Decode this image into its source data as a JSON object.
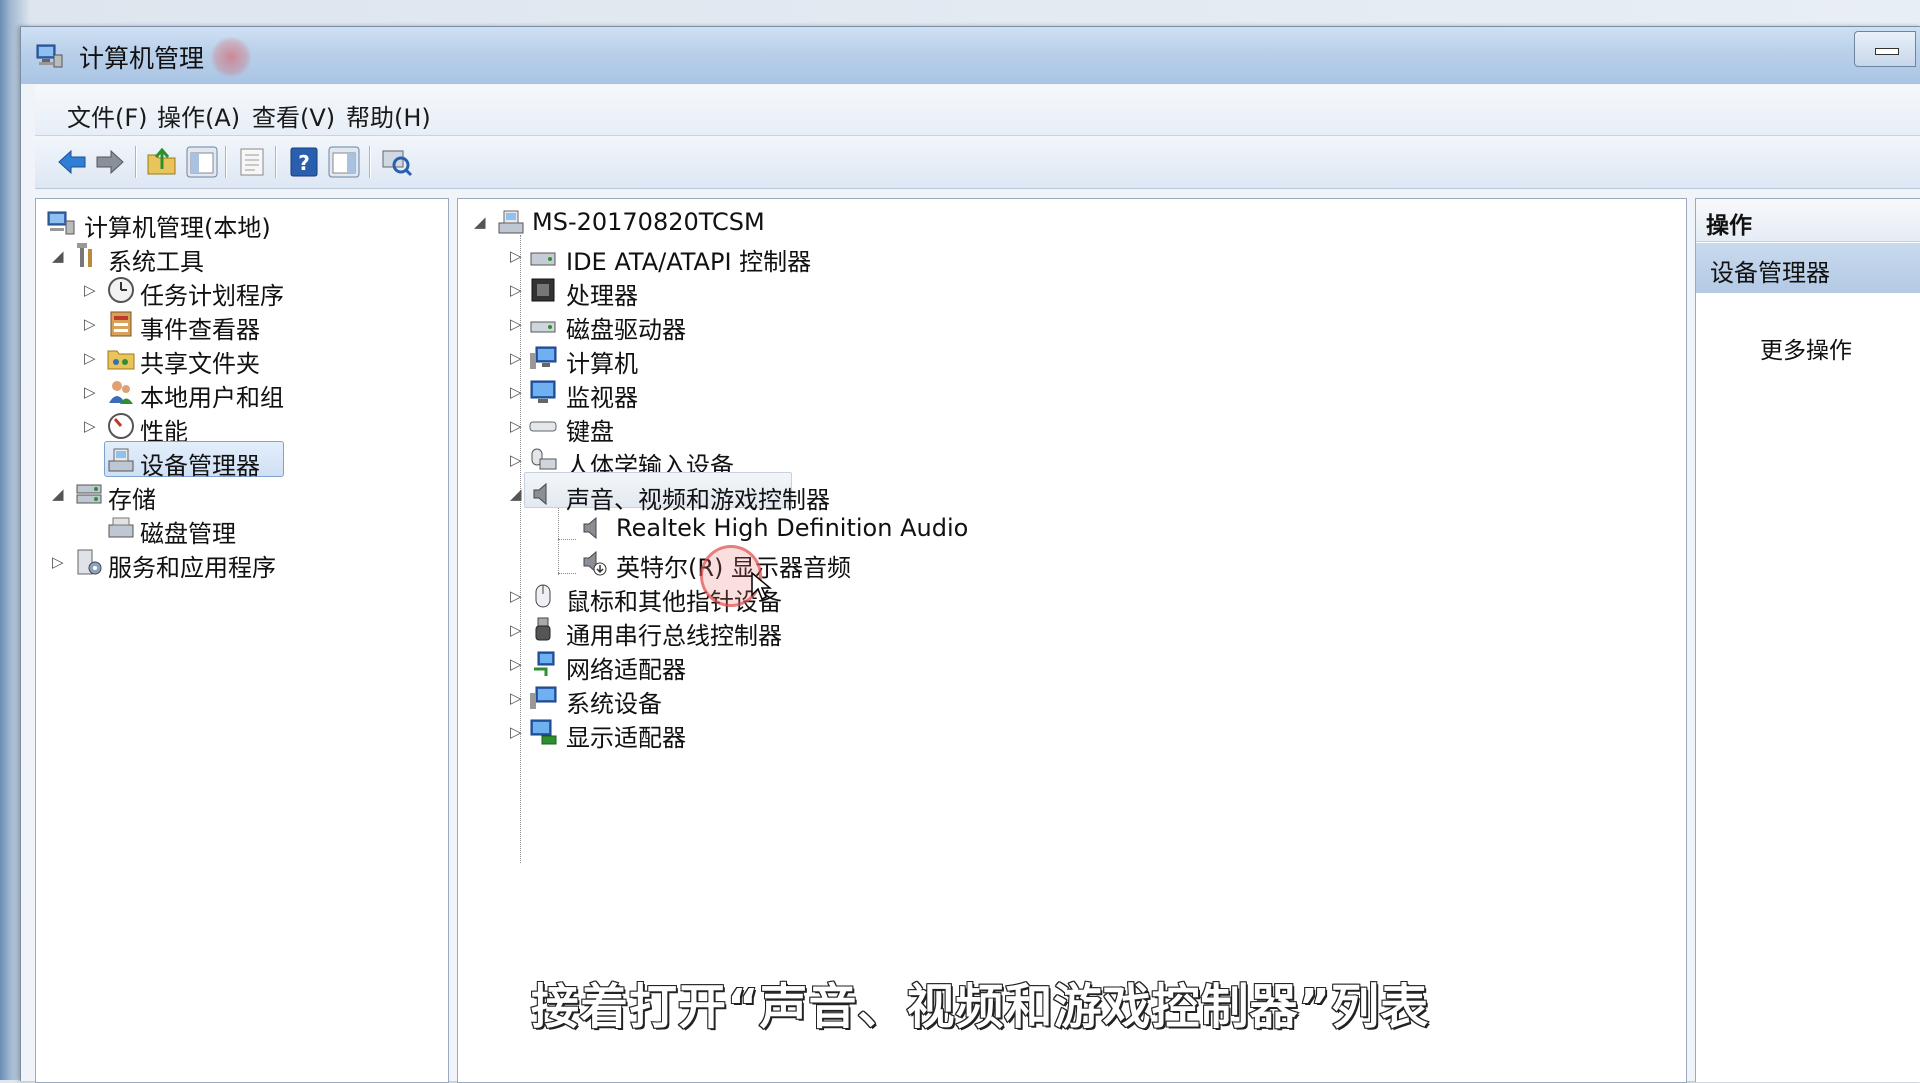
{
  "window": {
    "title": "计算机管理",
    "app_icon": "computer-management-icon"
  },
  "menu": [
    "文件(F)",
    "操作(A)",
    "查看(V)",
    "帮助(H)"
  ],
  "toolbar": {
    "buttons": [
      "back-icon",
      "forward-icon",
      "up-folder-icon",
      "show-hide-tree-icon",
      "properties-icon",
      "help-icon",
      "show-hide-action-pane-icon",
      "scan-hardware-icon"
    ]
  },
  "left_tree": {
    "root": "计算机管理(本地)",
    "system_tools": "系统工具",
    "task_scheduler": "任务计划程序",
    "event_viewer": "事件查看器",
    "shared_folders": "共享文件夹",
    "local_users": "本地用户和组",
    "performance": "性能",
    "device_manager": "设备管理器",
    "storage": "存储",
    "disk_management": "磁盘管理",
    "services_apps": "服务和应用程序"
  },
  "device_tree": {
    "computer_name": "MS-20170820TCSM",
    "categories": [
      {
        "label": "IDE ATA/ATAPI 控制器",
        "icon": "ide-controller-icon"
      },
      {
        "label": "处理器",
        "icon": "processor-icon"
      },
      {
        "label": "磁盘驱动器",
        "icon": "disk-drive-icon"
      },
      {
        "label": "计算机",
        "icon": "computer-icon"
      },
      {
        "label": "监视器",
        "icon": "monitor-icon"
      },
      {
        "label": "键盘",
        "icon": "keyboard-icon"
      },
      {
        "label": "人体学输入设备",
        "icon": "hid-icon"
      },
      {
        "label": "声音、视频和游戏控制器",
        "icon": "speaker-icon"
      },
      {
        "label": "鼠标和其他指针设备",
        "icon": "mouse-icon"
      },
      {
        "label": "通用串行总线控制器",
        "icon": "usb-icon"
      },
      {
        "label": "网络适配器",
        "icon": "network-adapter-icon"
      },
      {
        "label": "系统设备",
        "icon": "system-device-icon"
      },
      {
        "label": "显示适配器",
        "icon": "display-adapter-icon"
      }
    ],
    "audio_children": [
      {
        "label": "Realtek High Definition Audio",
        "icon": "speaker-icon"
      },
      {
        "label": "英特尔(R) 显示器音频",
        "icon": "speaker-icon"
      }
    ]
  },
  "actions": {
    "header": "操作",
    "section": "设备管理器",
    "more": "更多操作"
  },
  "subtitle": "接着打开“声音、视频和游戏控制器”列表"
}
